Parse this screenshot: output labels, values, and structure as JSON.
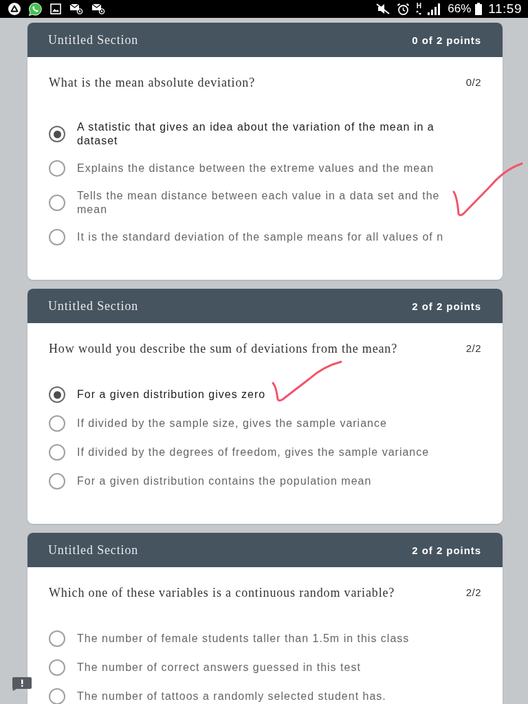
{
  "status_bar": {
    "network_type": "H",
    "battery": "66%",
    "time": "11:59"
  },
  "sections": [
    {
      "title": "Untitled Section",
      "score": "0 of 2 points",
      "question": "What is the mean absolute deviation?",
      "points": "0/2",
      "options": [
        {
          "label": "A statistic that gives an idea about the variation of the mean in a dataset",
          "selected": true,
          "ticked": false
        },
        {
          "label": "Explains the distance between the extreme values and the mean",
          "selected": false,
          "ticked": false
        },
        {
          "label": "Tells the mean distance between each value in a data set and the mean",
          "selected": false,
          "ticked": true
        },
        {
          "label": "It is the standard deviation of the sample means for all values of n",
          "selected": false,
          "ticked": false
        }
      ]
    },
    {
      "title": "Untitled Section",
      "score": "2 of 2 points",
      "question": "How would you describe the sum of deviations from the mean?",
      "points": "2/2",
      "options": [
        {
          "label": "For a given distribution gives zero",
          "selected": true,
          "ticked": true
        },
        {
          "label": "If divided by the sample size, gives the sample variance",
          "selected": false,
          "ticked": false
        },
        {
          "label": "If divided by the degrees of freedom, gives the sample variance",
          "selected": false,
          "ticked": false
        },
        {
          "label": "For a given distribution contains the population mean",
          "selected": false,
          "ticked": false
        }
      ]
    },
    {
      "title": "Untitled Section",
      "score": "2 of 2 points",
      "question": "Which one of these variables is a continuous random variable?",
      "points": "2/2",
      "options": [
        {
          "label": "The number of female students taller than 1.5m in this class",
          "selected": false,
          "ticked": false
        },
        {
          "label": "The number of correct answers guessed in this test",
          "selected": false,
          "ticked": false
        },
        {
          "label": "The number of tattoos a randomly selected student has.",
          "selected": false,
          "ticked": false
        }
      ]
    }
  ]
}
